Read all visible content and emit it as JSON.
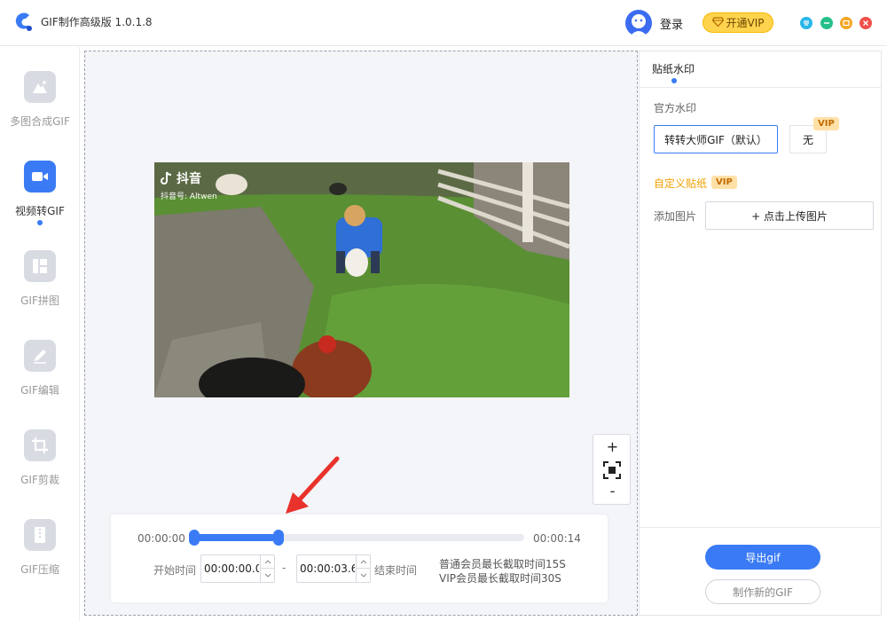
{
  "app": {
    "title": "GIF制作高级版 1.0.1.8",
    "logo_icon": "app-logo-icon",
    "login_label": "登录",
    "vip_button_label": "开通VIP",
    "window_controls": [
      {
        "name": "menu-icon",
        "color": "#29b6e8"
      },
      {
        "name": "minimize-icon",
        "color": "#25c08a"
      },
      {
        "name": "maximize-icon",
        "color": "#f5a623"
      },
      {
        "name": "close-icon",
        "color": "#f0504a"
      }
    ]
  },
  "sidebar": {
    "items": [
      {
        "label": "多图合成GIF",
        "icon": "mountain-icon",
        "active": false
      },
      {
        "label": "视频转GIF",
        "icon": "video-camera-icon",
        "active": true
      },
      {
        "label": "GIF拼图",
        "icon": "collage-icon",
        "active": false
      },
      {
        "label": "GIF编辑",
        "icon": "pencil-icon",
        "active": false
      },
      {
        "label": "GIF剪裁",
        "icon": "crop-icon",
        "active": false
      },
      {
        "label": "GIF压缩",
        "icon": "zip-icon",
        "active": false
      }
    ]
  },
  "preview": {
    "watermark_brand": "抖音",
    "watermark_id": "抖音号: Altwen"
  },
  "zoom": {
    "plus": "+",
    "minus": "-",
    "fit_icon": "fit-screen-icon"
  },
  "timeline": {
    "start_time": "00:00:00",
    "end_time": "00:00:14",
    "selection_fraction": 0.26,
    "start_label": "开始时间",
    "end_label": "结束时间",
    "start_value": "00:00:00.0",
    "end_value": "00:00:03.6",
    "separator": "-",
    "note_line1": "普通会员最长截取时间15S",
    "note_line2": "VIP会员最长截取时间30S"
  },
  "panel": {
    "tab_label": "贴纸水印",
    "official_label": "官方水印",
    "default_watermark": "转转大师GIF（默认）",
    "none_option": "无",
    "vip_tag": "VIP",
    "custom_label": "自定义贴纸",
    "add_image_label": "添加图片",
    "upload_button": "+ 点击上传图片",
    "export_button": "导出gif",
    "new_button": "制作新的GIF"
  },
  "colors": {
    "accent": "#3a7bf5",
    "vip_yellow": "#ffd34d",
    "custom_label": "#f0a000"
  }
}
